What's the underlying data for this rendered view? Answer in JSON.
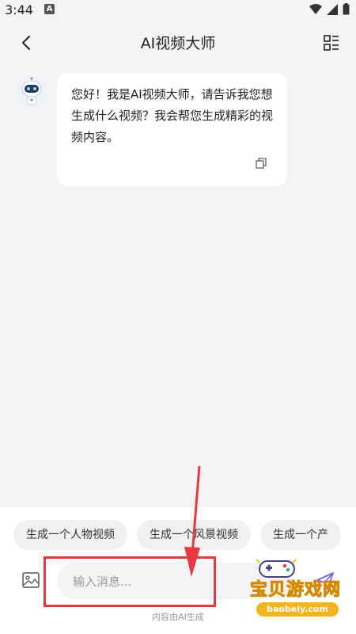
{
  "status_bar": {
    "time": "3:44",
    "notification_letter": "A"
  },
  "navbar": {
    "title": "AI视频大师"
  },
  "message": {
    "sender_avatar": "robot-avatar-icon",
    "text": "您好！我是AI视频大师，请告诉我您想生成什么视频？我会帮您生成精彩的视频内容。"
  },
  "suggestions": [
    "生成一个人物视频",
    "生成一个风景视频",
    "生成一个产"
  ],
  "composer": {
    "placeholder": "输入消息..."
  },
  "disclaimer": "内容由AI生成",
  "watermark": {
    "title": "宝贝游戏网",
    "url": "baobeiy.com"
  },
  "colors": {
    "accent": "#7b5cff",
    "annotation": "#e8383d",
    "watermark": "#f0c419"
  }
}
